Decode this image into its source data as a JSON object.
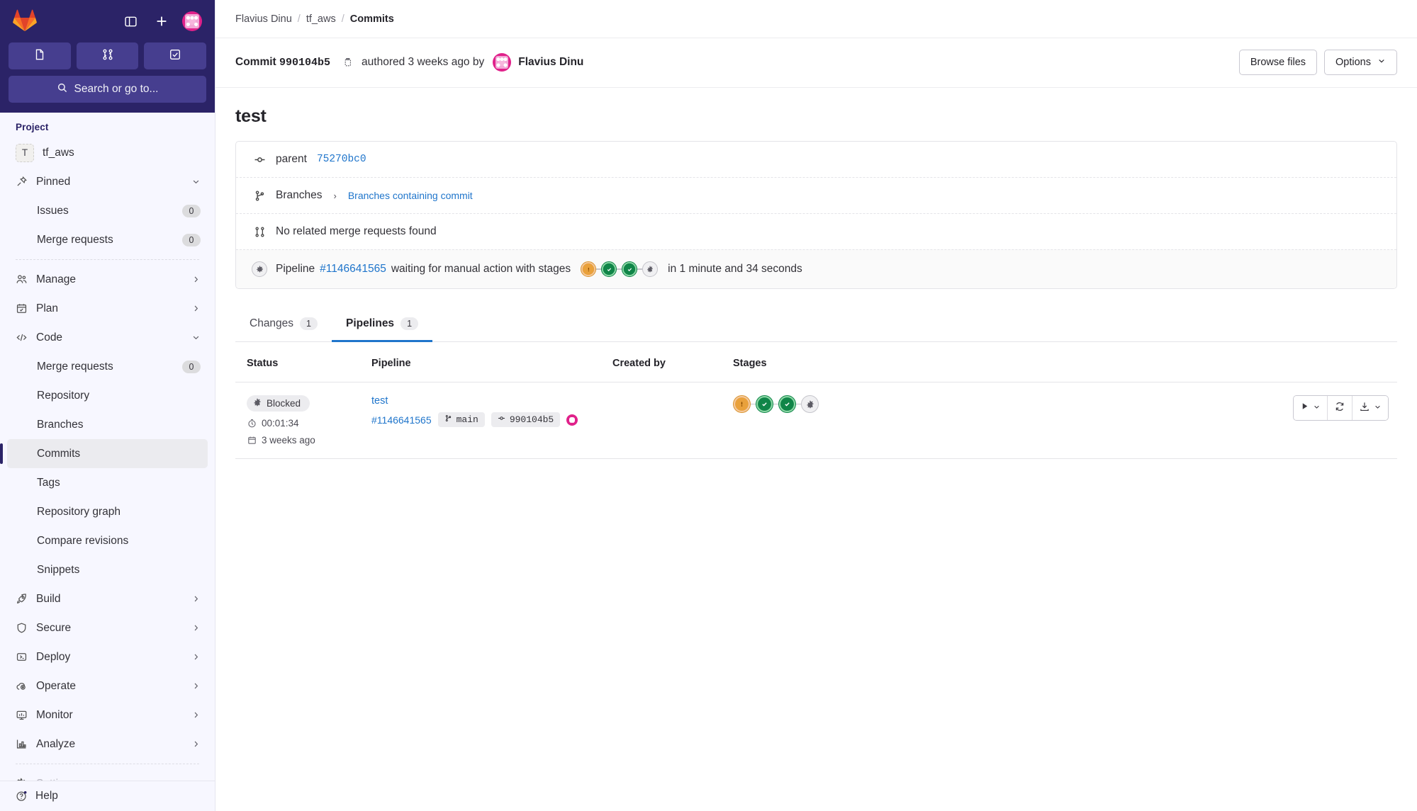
{
  "sidebar": {
    "logo_icon": "gitlab-logo-icon",
    "toggle_icon": "sidebar-toggle-icon",
    "new_icon": "plus-icon",
    "avatar_icon": "user-avatar",
    "quick_buttons": [
      {
        "name": "issues-shortcut",
        "icon": "issue-document-icon"
      },
      {
        "name": "merge-requests-shortcut",
        "icon": "merge-request-icon"
      },
      {
        "name": "todos-shortcut",
        "icon": "todo-checkbox-icon"
      }
    ],
    "search_placeholder": "Search or go to...",
    "section_title": "Project",
    "project": {
      "initial": "T",
      "name": "tf_aws"
    },
    "items": [
      {
        "label": "Pinned",
        "icon": "pin-icon",
        "chevron": "down",
        "count": null,
        "indent": false
      },
      {
        "label": "Issues",
        "icon": null,
        "chevron": null,
        "count": "0",
        "indent": true
      },
      {
        "label": "Merge requests",
        "icon": null,
        "chevron": null,
        "count": "0",
        "indent": true
      },
      {
        "label": "Manage",
        "icon": "users-icon",
        "chevron": "right",
        "count": null,
        "indent": false
      },
      {
        "label": "Plan",
        "icon": "calendar-icon",
        "chevron": "right",
        "count": null,
        "indent": false
      },
      {
        "label": "Code",
        "icon": "code-icon",
        "chevron": "down",
        "count": null,
        "indent": false
      },
      {
        "label": "Merge requests",
        "icon": null,
        "chevron": null,
        "count": "0",
        "indent": true
      },
      {
        "label": "Repository",
        "icon": null,
        "chevron": null,
        "count": null,
        "indent": true
      },
      {
        "label": "Branches",
        "icon": null,
        "chevron": null,
        "count": null,
        "indent": true
      },
      {
        "label": "Commits",
        "icon": null,
        "chevron": null,
        "count": null,
        "indent": true,
        "active": true
      },
      {
        "label": "Tags",
        "icon": null,
        "chevron": null,
        "count": null,
        "indent": true
      },
      {
        "label": "Repository graph",
        "icon": null,
        "chevron": null,
        "count": null,
        "indent": true
      },
      {
        "label": "Compare revisions",
        "icon": null,
        "chevron": null,
        "count": null,
        "indent": true
      },
      {
        "label": "Snippets",
        "icon": null,
        "chevron": null,
        "count": null,
        "indent": true
      },
      {
        "label": "Build",
        "icon": "rocket-icon",
        "chevron": "right",
        "count": null,
        "indent": false
      },
      {
        "label": "Secure",
        "icon": "shield-icon",
        "chevron": "right",
        "count": null,
        "indent": false
      },
      {
        "label": "Deploy",
        "icon": "deploy-icon",
        "chevron": "right",
        "count": null,
        "indent": false
      },
      {
        "label": "Operate",
        "icon": "cloud-gear-icon",
        "chevron": "right",
        "count": null,
        "indent": false
      },
      {
        "label": "Monitor",
        "icon": "monitor-icon",
        "chevron": "right",
        "count": null,
        "indent": false
      },
      {
        "label": "Analyze",
        "icon": "chart-icon",
        "chevron": "right",
        "count": null,
        "indent": false
      },
      {
        "label": "Settings",
        "icon": "gear-icon",
        "chevron": "right",
        "count": null,
        "indent": false,
        "dim": true
      }
    ],
    "help": {
      "label": "Help",
      "icon": "help-circle-icon"
    }
  },
  "breadcrumb": {
    "items": [
      "Flavius Dinu",
      "tf_aws"
    ],
    "current": "Commits",
    "separator": "/"
  },
  "commit_header": {
    "prefix": "Commit",
    "sha": "990104b5",
    "copy_icon": "copy-clipboard-icon",
    "authored_text": "authored 3 weeks ago by",
    "author": "Flavius Dinu",
    "browse_files_label": "Browse files",
    "options_label": "Options"
  },
  "commit": {
    "title": "test",
    "parent_label": "parent",
    "parent_sha": "75270bc0",
    "branches_label": "Branches",
    "branches_link": "Branches containing commit",
    "no_mr_text": "No related merge requests found",
    "pipeline_prefix": "Pipeline",
    "pipeline_id": "#1146641565",
    "pipeline_status_text": "waiting for manual action with stages",
    "pipeline_duration_text": "in 1 minute and 34 seconds",
    "stages": [
      "warn",
      "ok",
      "ok",
      "idle"
    ]
  },
  "tabs": [
    {
      "label": "Changes",
      "count": "1",
      "active": false
    },
    {
      "label": "Pipelines",
      "count": "1",
      "active": true
    }
  ],
  "pipelines_table": {
    "columns": [
      "Status",
      "Pipeline",
      "Created by",
      "Stages",
      ""
    ],
    "rows": [
      {
        "status_badge": "Blocked",
        "status_icon": "gear-icon",
        "duration": "00:01:34",
        "duration_icon": "timer-icon",
        "age": "3 weeks ago",
        "age_icon": "calendar-icon",
        "pipeline_name": "test",
        "pipeline_id": "#1146641565",
        "branch": "main",
        "branch_icon": "branch-icon",
        "commit_sha": "990104b5",
        "commit_icon": "commit-icon",
        "stages": [
          "warn",
          "ok",
          "ok",
          "idle"
        ],
        "actions": [
          {
            "name": "run-manual-action-button",
            "icon": "play-icon",
            "has_chevron": true
          },
          {
            "name": "retry-pipeline-button",
            "icon": "retry-icon",
            "has_chevron": false
          },
          {
            "name": "download-artifacts-button",
            "icon": "download-icon",
            "has_chevron": true
          }
        ]
      }
    ]
  },
  "colors": {
    "sidebar_top": "#2b2367",
    "sidebar_bg": "#f7f7ff",
    "link": "#1f75cb",
    "success": "#108548",
    "warning": "#d99530",
    "avatar": "#e0218a"
  }
}
